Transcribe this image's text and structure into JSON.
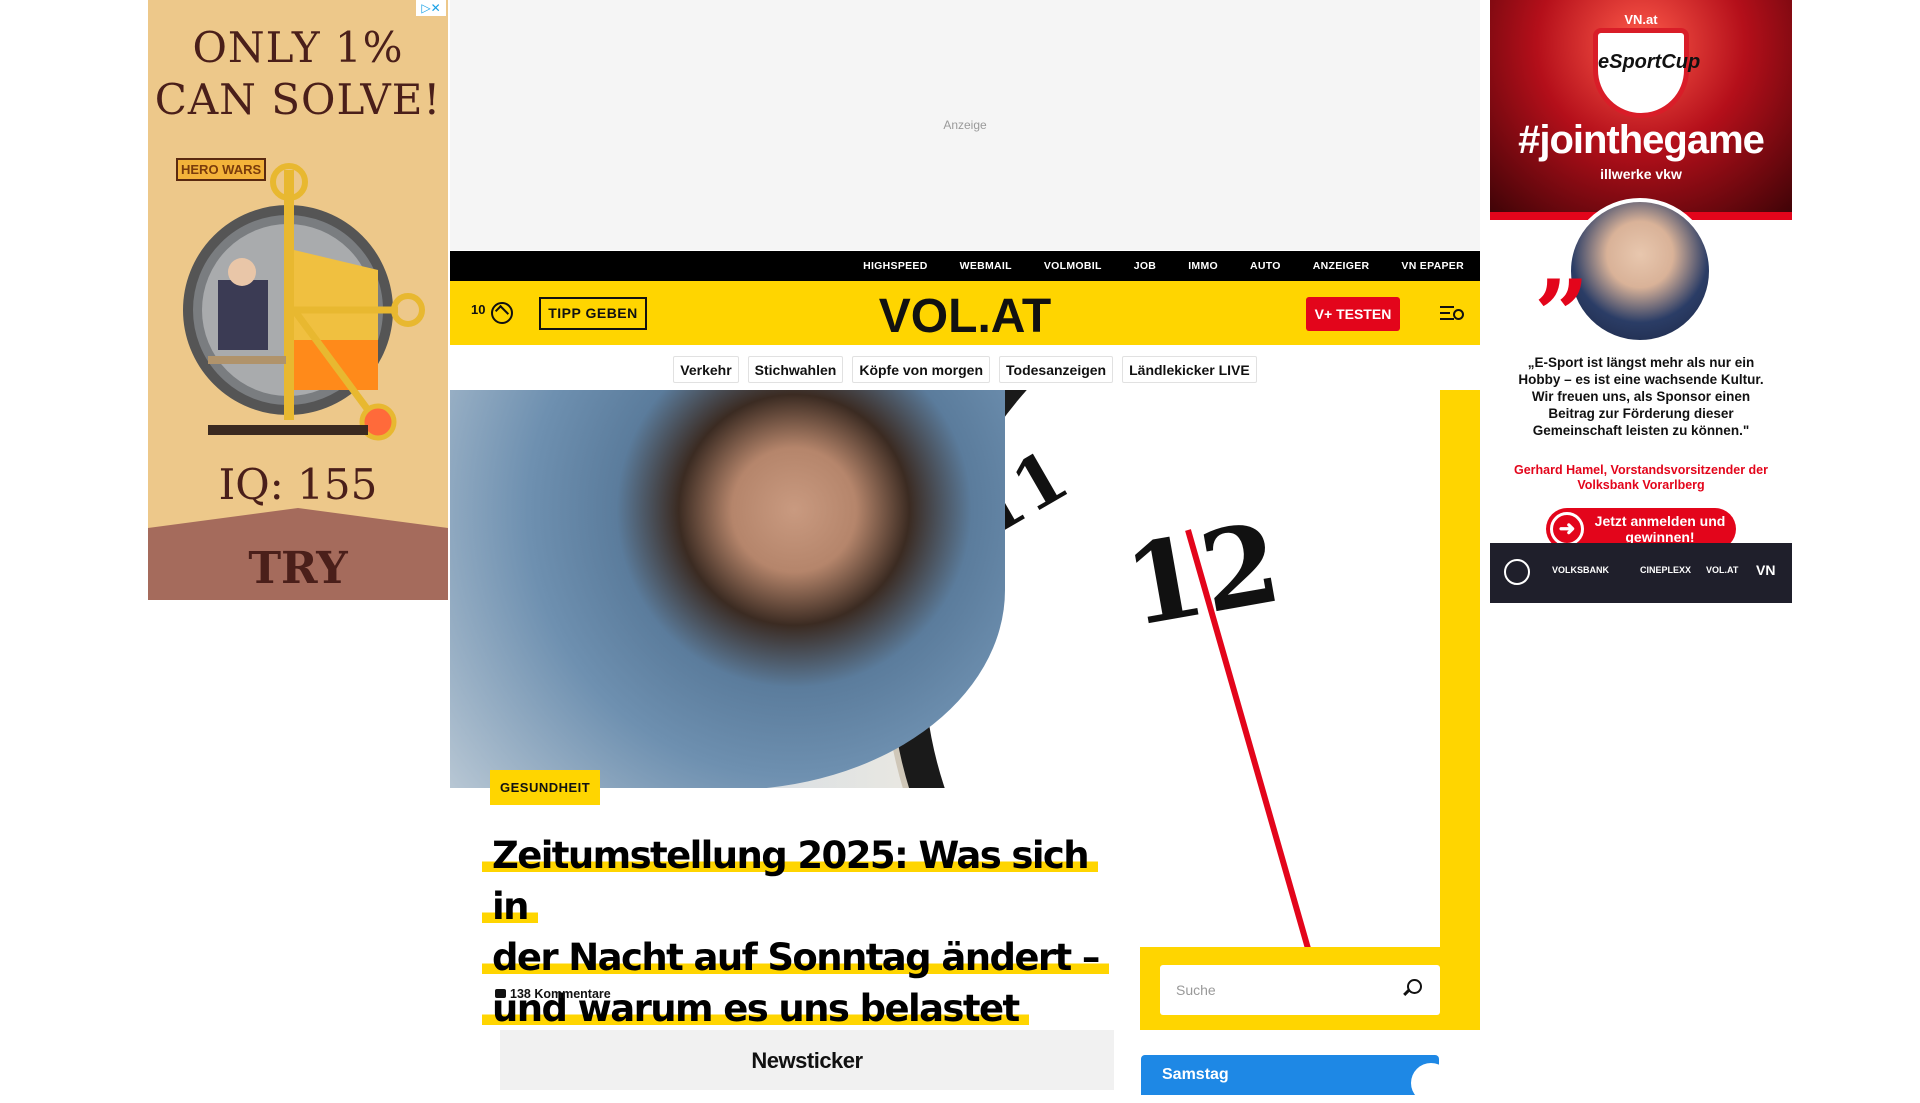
{
  "ads": {
    "left": {
      "headline": "ONLY 1% CAN SOLVE!",
      "brand": "HERO WARS",
      "iq": "IQ: 155",
      "cta": "TRY"
    },
    "top": {
      "label": "Anzeige"
    },
    "right": {
      "vnat": "VN.at",
      "cup": "eSportCup",
      "hashtag": "#jointhegame",
      "powered": "illwerke vkw",
      "quote": "„E-Sport ist längst mehr als nur ein Hobby – es ist eine wachsende Kultur. Wir freuen uns, als Sponsor einen Beitrag zur Förderung dieser Gemeinschaft leisten zu können.\"",
      "author": "Gerhard Hamel, Vorstandsvorsitzender der Volksbank Vorarlberg",
      "cta": "Jetzt anmelden und gewinnen!",
      "sponsors": [
        "VOLKSBANK",
        "CINEPLEXX",
        "VOL.AT",
        "VN"
      ]
    }
  },
  "topbar": {
    "links": [
      "HIGHSPEED",
      "WEBMAIL",
      "VOLMOBIL",
      "JOB",
      "IMMO",
      "AUTO",
      "ANZEIGER",
      "VN EPAPER"
    ]
  },
  "header": {
    "temperature": "10",
    "tipp_button": "TIPP GEBEN",
    "logo": "VOL.AT",
    "vplus_button": "V+ TESTEN"
  },
  "category_nav": [
    "Verkehr",
    "Stichwahlen",
    "Köpfe von morgen",
    "Todesanzeigen",
    "Ländlekicker LIVE"
  ],
  "hero": {
    "category": "GESUNDHEIT",
    "title_lines": [
      "Zeitumstellung 2025: Was sich in",
      "der Nacht auf Sonntag ändert –",
      "und warum es uns belastet"
    ],
    "comments": "138 Kommentare",
    "clock_numbers": [
      "11",
      "12"
    ]
  },
  "search": {
    "placeholder": "Suche"
  },
  "newsticker": {
    "heading": "Newsticker"
  },
  "weather_widget": {
    "day": "Samstag"
  },
  "colors": {
    "brand_yellow": "#ffd500",
    "accent_red": "#e3051b",
    "topbar_black": "#000000",
    "weather_blue": "#1e88e5"
  }
}
